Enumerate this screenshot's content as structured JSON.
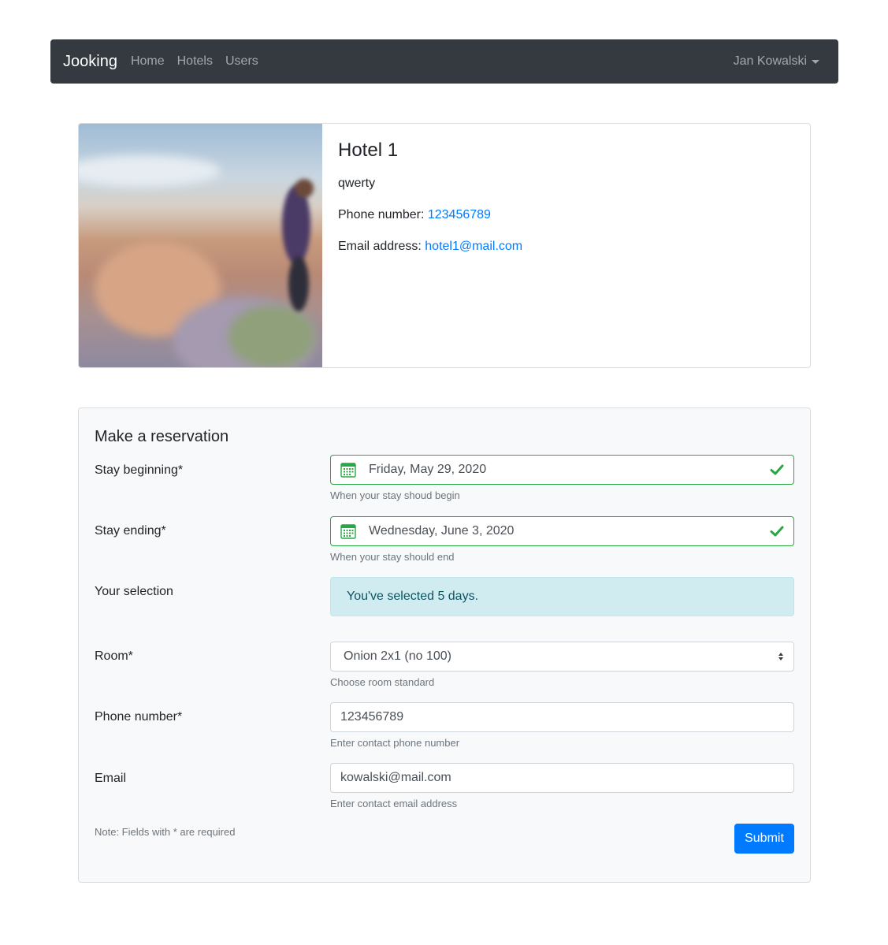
{
  "nav": {
    "brand": "Jooking",
    "links": [
      "Home",
      "Hotels",
      "Users"
    ],
    "user": "Jan Kowalski"
  },
  "hotel": {
    "name": "Hotel 1",
    "description": "qwerty",
    "phone_label": "Phone number: ",
    "phone": "123456789",
    "email_label": "Email address: ",
    "email": "hotel1@mail.com"
  },
  "reservation": {
    "title": "Make a reservation",
    "stay_begin": {
      "label": "Stay beginning*",
      "value": "Friday, May 29, 2020",
      "help": "When your stay shoud begin"
    },
    "stay_end": {
      "label": "Stay ending*",
      "value": "Wednesday, June 3, 2020",
      "help": "When your stay should end"
    },
    "selection": {
      "label": "Your selection",
      "message": "You've selected 5 days."
    },
    "room": {
      "label": "Room*",
      "value": "Onion 2x1 (no 100)",
      "help": "Choose room standard"
    },
    "phone": {
      "label": "Phone number*",
      "value": "123456789",
      "help": "Enter contact phone number"
    },
    "email": {
      "label": "Email",
      "value": "kowalski@mail.com",
      "help": "Enter contact email address"
    },
    "note": "Note: Fields with * are required",
    "submit": "Submit"
  },
  "colors": {
    "navbar": "#343a40",
    "link": "#007bff",
    "valid": "#28a745",
    "alert_bg": "#d1ecf1",
    "primary": "#007bff"
  }
}
